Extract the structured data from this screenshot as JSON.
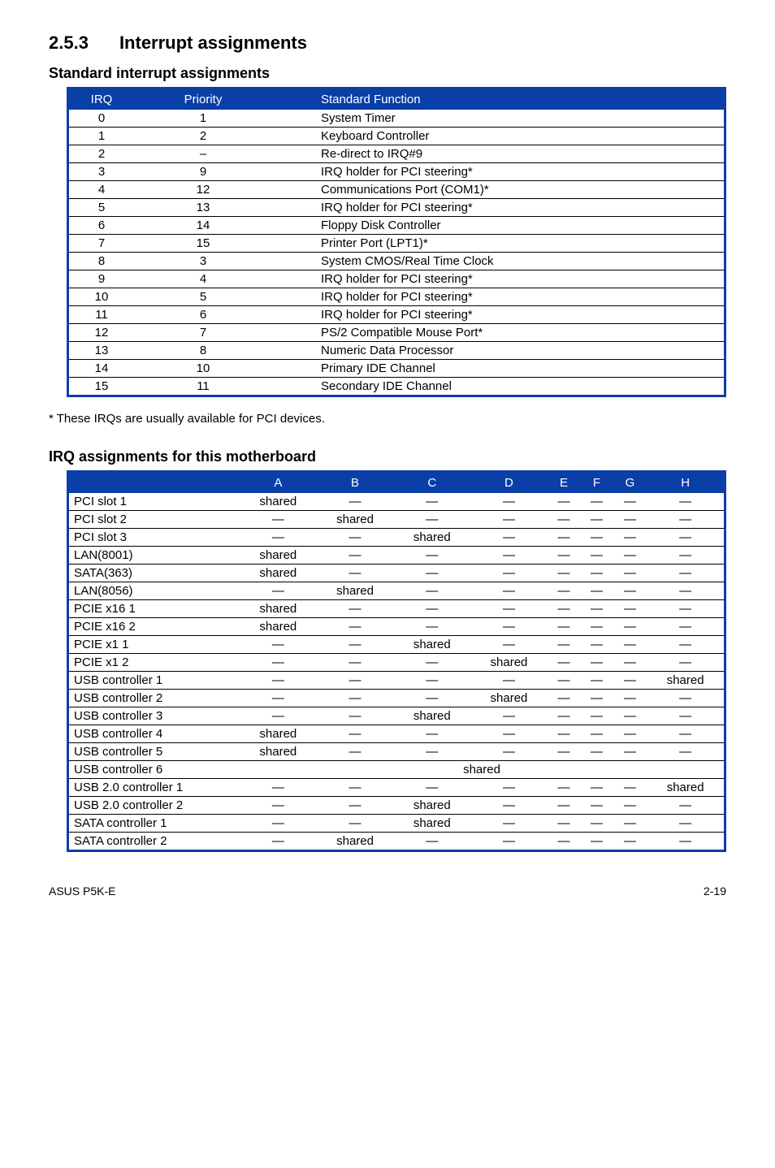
{
  "section": {
    "num": "2.5.3",
    "title": "Interrupt assignments"
  },
  "sub1": "Standard interrupt assignments",
  "std_headers": [
    "IRQ",
    "Priority",
    "Standard Function"
  ],
  "std_rows": [
    [
      "0",
      "1",
      "System Timer"
    ],
    [
      "1",
      "2",
      "Keyboard Controller"
    ],
    [
      "2",
      "–",
      "Re-direct to IRQ#9"
    ],
    [
      "3",
      "9",
      "IRQ holder for PCI steering*"
    ],
    [
      "4",
      "12",
      "Communications Port (COM1)*"
    ],
    [
      "5",
      "13",
      "IRQ holder for PCI steering*"
    ],
    [
      "6",
      "14",
      "Floppy Disk Controller"
    ],
    [
      "7",
      "15",
      "Printer Port (LPT1)*"
    ],
    [
      "8",
      "3",
      "System CMOS/Real Time Clock"
    ],
    [
      "9",
      "4",
      "IRQ holder for PCI steering*"
    ],
    [
      "10",
      "5",
      "IRQ holder for PCI steering*"
    ],
    [
      "11",
      "6",
      "IRQ holder for PCI steering*"
    ],
    [
      "12",
      "7",
      "PS/2 Compatible Mouse Port*"
    ],
    [
      "13",
      "8",
      "Numeric Data Processor"
    ],
    [
      "14",
      "10",
      "Primary IDE Channel"
    ],
    [
      "15",
      "11",
      "Secondary IDE Channel"
    ]
  ],
  "note": "* These IRQs are usually available for PCI devices.",
  "sub2": "IRQ assignments for this motherboard",
  "irq_headers": [
    "",
    "A",
    "B",
    "C",
    "D",
    "E",
    "F",
    "G",
    "H"
  ],
  "irq_rows": [
    {
      "name": "PCI slot 1",
      "a": "shared",
      "b": "—",
      "c": "—",
      "d": "—",
      "e": "—",
      "f": "—",
      "g": "—",
      "h": "—"
    },
    {
      "name": "PCI slot 2",
      "a": "—",
      "b": "shared",
      "c": "—",
      "d": "—",
      "e": "—",
      "f": "—",
      "g": "—",
      "h": "—"
    },
    {
      "name": "PCI slot 3",
      "a": "—",
      "b": "—",
      "c": "shared",
      "d": "—",
      "e": "—",
      "f": "—",
      "g": "—",
      "h": "—"
    },
    {
      "name": "LAN(8001)",
      "a": "shared",
      "b": "—",
      "c": "—",
      "d": "—",
      "e": "—",
      "f": "—",
      "g": "—",
      "h": "—"
    },
    {
      "name": "SATA(363)",
      "a": "shared",
      "b": "—",
      "c": "—",
      "d": "—",
      "e": "—",
      "f": "—",
      "g": "—",
      "h": "—"
    },
    {
      "name": "LAN(8056)",
      "a": "—",
      "b": "shared",
      "c": "—",
      "d": "—",
      "e": "—",
      "f": "—",
      "g": "—",
      "h": "—"
    },
    {
      "name": "PCIE x16 1",
      "a": "shared",
      "b": "—",
      "c": "—",
      "d": "—",
      "e": "—",
      "f": "—",
      "g": "—",
      "h": "—"
    },
    {
      "name": "PCIE x16 2",
      "a": "shared",
      "b": "—",
      "c": "—",
      "d": "—",
      "e": "—",
      "f": "—",
      "g": "—",
      "h": "—"
    },
    {
      "name": "PCIE x1 1",
      "a": "—",
      "b": "—",
      "c": "shared",
      "d": "—",
      "e": "—",
      "f": "—",
      "g": "—",
      "h": "—"
    },
    {
      "name": "PCIE x1 2",
      "a": "—",
      "b": "—",
      "c": "—",
      "d": "shared",
      "e": "—",
      "f": "—",
      "g": "—",
      "h": "—"
    },
    {
      "name": "USB controller 1",
      "a": "—",
      "b": "—",
      "c": "—",
      "d": "—",
      "e": "—",
      "f": "—",
      "g": "—",
      "h": "shared"
    },
    {
      "name": "USB controller 2",
      "a": "—",
      "b": "—",
      "c": "—",
      "d": "shared",
      "e": "—",
      "f": "—",
      "g": "—",
      "h": "—"
    },
    {
      "name": "USB controller 3",
      "a": "—",
      "b": "—",
      "c": "shared",
      "d": "—",
      "e": "—",
      "f": "—",
      "g": "—",
      "h": "—"
    },
    {
      "name": "USB controller 4",
      "a": "shared",
      "b": "—",
      "c": "—",
      "d": "—",
      "e": "—",
      "f": "—",
      "g": "—",
      "h": "—"
    },
    {
      "name": "USB controller 5",
      "a": "shared",
      "b": "—",
      "c": "—",
      "d": "—",
      "e": "—",
      "f": "—",
      "g": "—",
      "h": "—"
    },
    {
      "name": "USB controller 6",
      "merged": "shared"
    },
    {
      "name": "USB 2.0 controller 1",
      "a": "—",
      "b": "—",
      "c": "—",
      "d": "—",
      "e": "—",
      "f": "—",
      "g": "—",
      "h": "shared"
    },
    {
      "name": "USB 2.0 controller 2",
      "a": "—",
      "b": "—",
      "c": "shared",
      "d": "—",
      "e": "—",
      "f": "—",
      "g": "—",
      "h": "—"
    },
    {
      "name": "SATA controller 1",
      "a": "—",
      "b": "—",
      "c": "shared",
      "d": "—",
      "e": "—",
      "f": "—",
      "g": "—",
      "h": "—"
    },
    {
      "name": "SATA controller 2",
      "a": "—",
      "b": "shared",
      "c": "—",
      "d": "—",
      "e": "—",
      "f": "—",
      "g": "—",
      "h": "—"
    }
  ],
  "footer": {
    "left": "ASUS P5K-E",
    "right": "2-19"
  }
}
